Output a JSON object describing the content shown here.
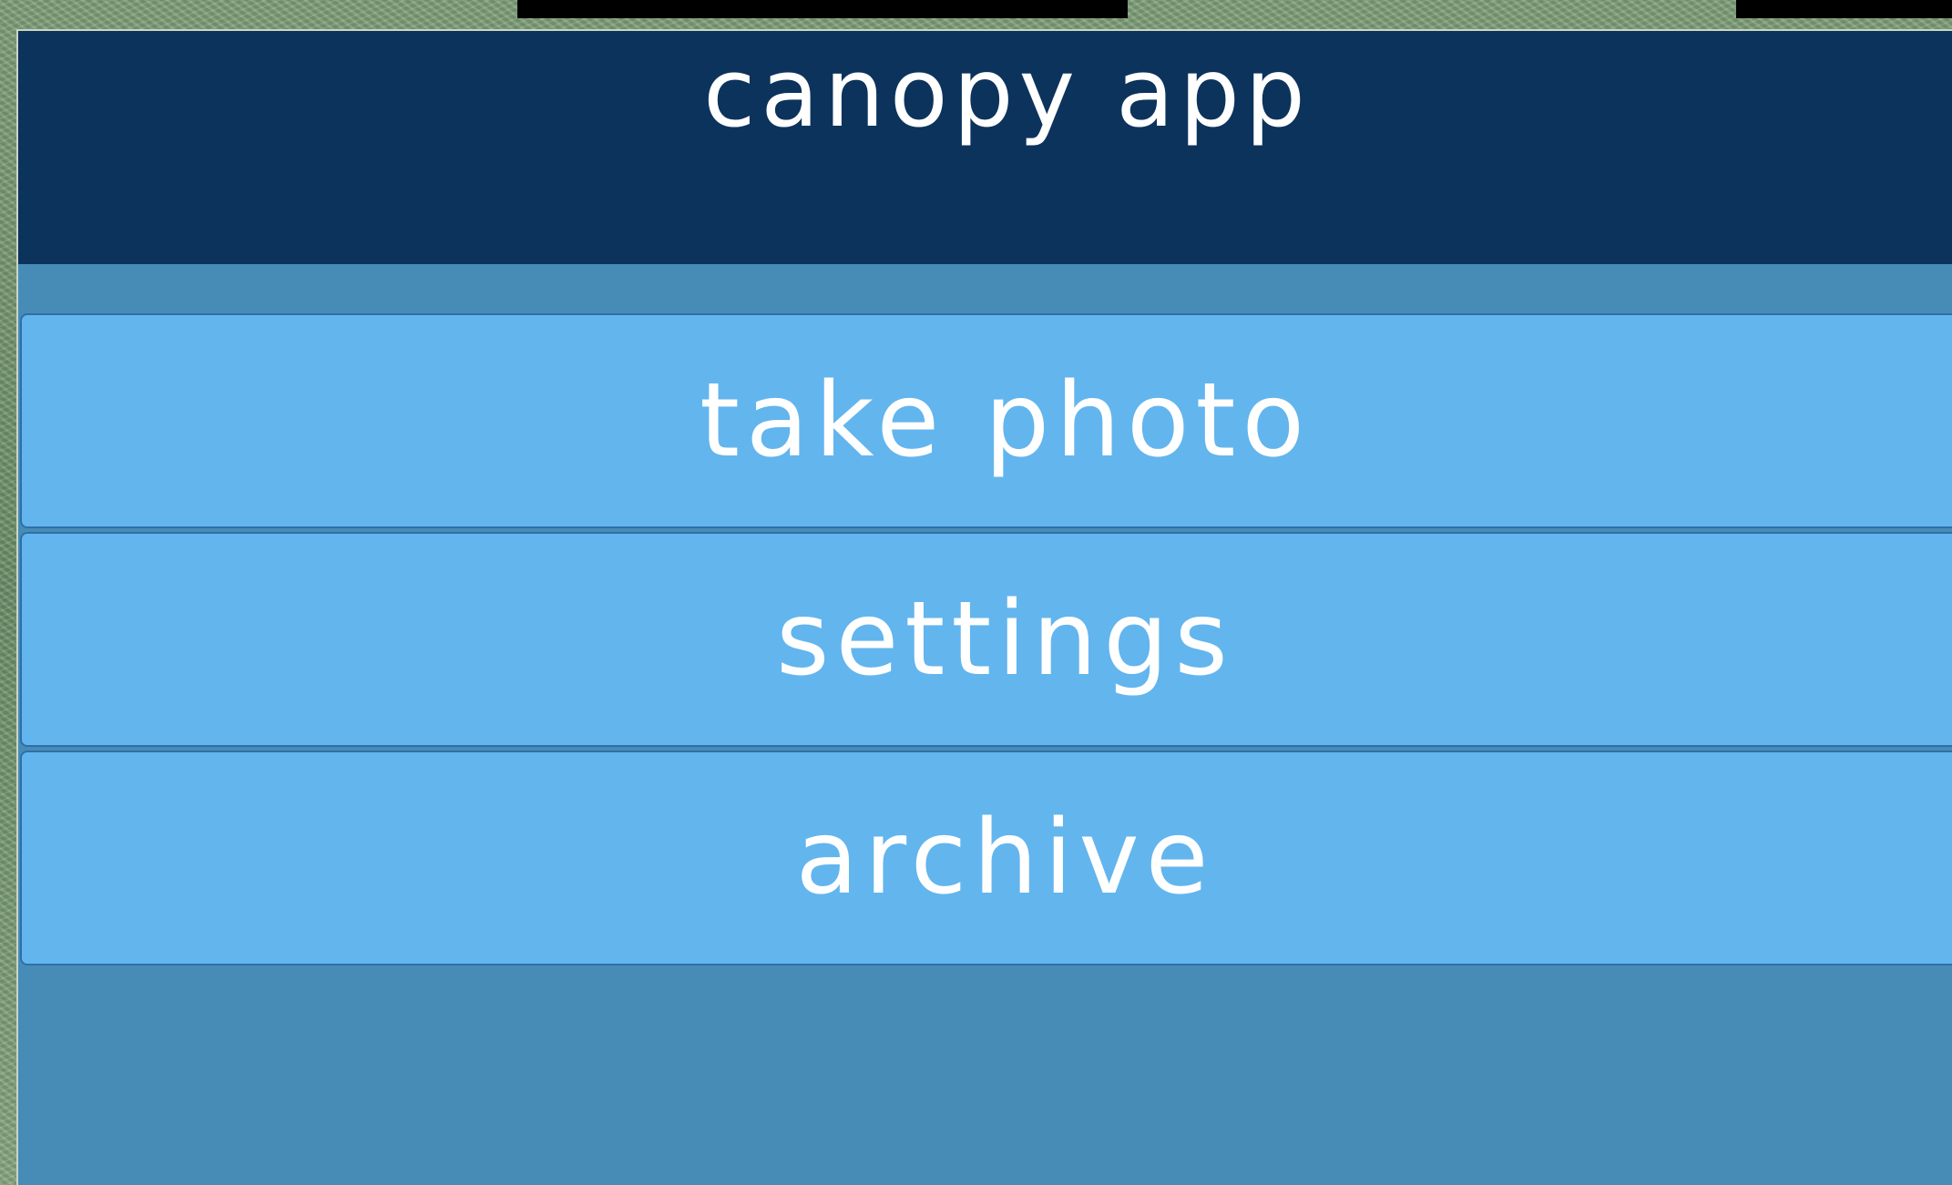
{
  "app": {
    "title": "canopy app"
  },
  "menu": {
    "items": [
      {
        "label": "take photo"
      },
      {
        "label": "settings"
      },
      {
        "label": "archive"
      }
    ]
  },
  "colors": {
    "header": "#0c335c",
    "background": "#478cb6",
    "button": "#63b5ee",
    "button_border": "#2f6fa8",
    "text": "#ffffff"
  }
}
